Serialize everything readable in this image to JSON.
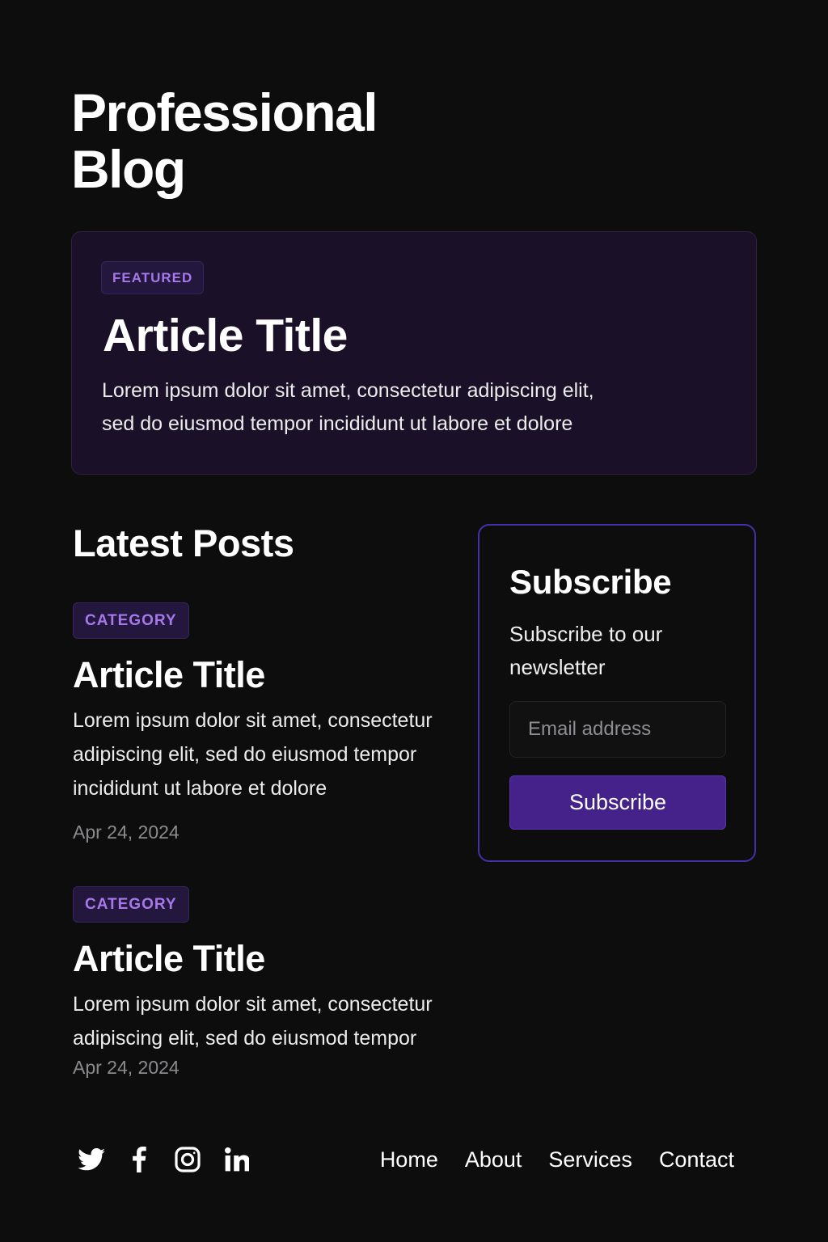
{
  "site": {
    "title": "Professional Blog"
  },
  "featured": {
    "badge": "FEATURED",
    "title": "Article Title",
    "excerpt": "Lorem ipsum dolor sit amet, consectetur adipiscing elit, sed do eiusmod tempor incididunt ut labore et dolore"
  },
  "latest": {
    "heading": "Latest Posts",
    "posts": [
      {
        "category": "CATEGORY",
        "title": "Article Title",
        "excerpt": "Lorem ipsum dolor sit amet, consectetur adipiscing elit, sed do eiusmod tempor incididunt ut labore et dolore",
        "date": "Apr 24, 2024"
      },
      {
        "category": "CATEGORY",
        "title": "Article Title",
        "excerpt": "Lorem ipsum dolor sit amet, consectetur adipiscing elit, sed do eiusmod tempor",
        "date": "Apr 24, 2024"
      }
    ]
  },
  "subscribe": {
    "title": "Subscribe",
    "description": "Subscribe to our newsletter",
    "email_placeholder": "Email address",
    "email_value": "",
    "button_label": "Subscribe"
  },
  "footer": {
    "social": [
      {
        "icon": "twitter-icon"
      },
      {
        "icon": "facebook-icon"
      },
      {
        "icon": "instagram-icon"
      },
      {
        "icon": "linkedin-icon"
      }
    ],
    "nav": [
      {
        "label": "Home"
      },
      {
        "label": "About"
      },
      {
        "label": "Services"
      },
      {
        "label": "Contact"
      }
    ]
  },
  "colors": {
    "background": "#0d0d0e",
    "card_background": "#1a1128",
    "accent_text": "#a678ea",
    "button_background": "#44228a",
    "card_border": "#4630a8",
    "muted_text": "#8b8b8e"
  }
}
